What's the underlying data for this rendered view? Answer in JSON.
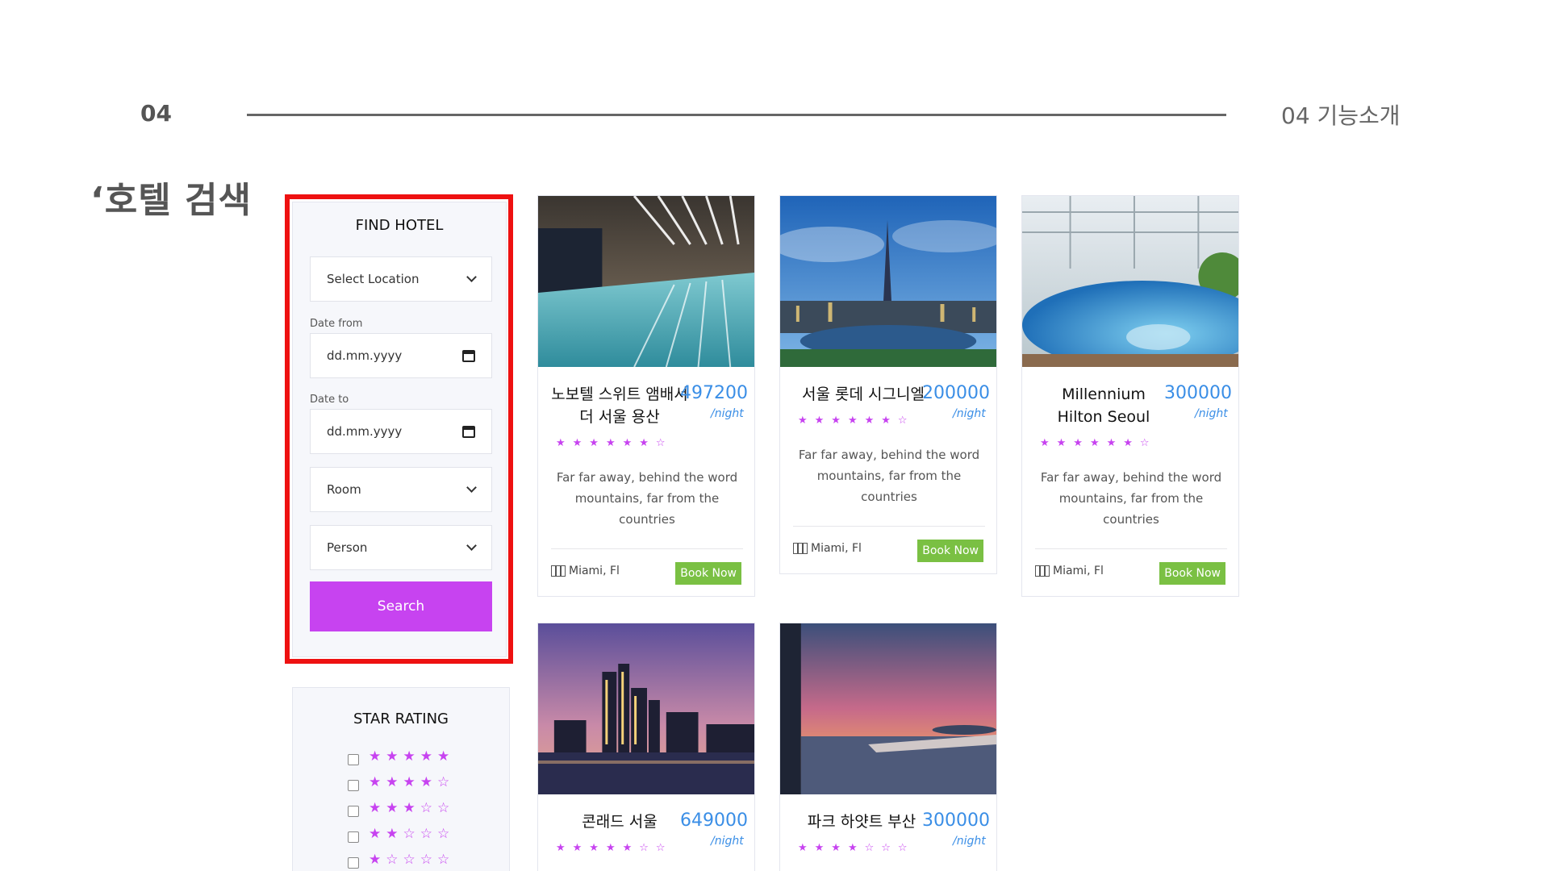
{
  "slide": {
    "number": "04",
    "section": "04 기능소개",
    "heading": "‘호텔 검색"
  },
  "find_hotel": {
    "title": "FIND HOTEL",
    "location_value": "Select Location",
    "date_from_label": "Date from",
    "date_from_value": "dd.mm.yyyy",
    "date_to_label": "Date to",
    "date_to_value": "dd.mm.yyyy",
    "room_value": "Room",
    "person_value": "Person",
    "search_label": "Search"
  },
  "star_rating": {
    "title": "STAR RATING",
    "rows": [
      "★★★★★",
      "★★★★☆",
      "★★★☆☆",
      "★★☆☆☆",
      "★☆☆☆☆"
    ]
  },
  "hotels": [
    {
      "name_1": "노보텔 스위트 앰배서",
      "name_2": "더 서울 용산",
      "price": "497200",
      "per": "/night",
      "stars": "★★★★★★☆",
      "desc_1": "Far far away, behind the word",
      "desc_2": "mountains, far from the",
      "desc_3": "countries",
      "location": "Miami, Fl",
      "book": "Book Now"
    },
    {
      "name_1": "서울 롯데 시그니엘",
      "name_2": "",
      "price": "200000",
      "per": "/night",
      "stars": "★★★★★★☆",
      "desc_1": "Far far away, behind the word",
      "desc_2": "mountains, far from the",
      "desc_3": "countries",
      "location": "Miami, Fl",
      "book": "Book Now"
    },
    {
      "name_1": "Millennium",
      "name_2": "Hilton Seoul",
      "price": "300000",
      "per": "/night",
      "stars": "★★★★★★☆",
      "desc_1": "Far far away, behind the word",
      "desc_2": "mountains, far from the",
      "desc_3": "countries",
      "location": "Miami, Fl",
      "book": "Book Now"
    },
    {
      "name_1": "콘래드 서울",
      "name_2": "",
      "price": "649000",
      "per": "/night",
      "stars": "★★★★★☆☆"
    },
    {
      "name_1": "파크 하얏트 부산",
      "name_2": "",
      "price": "300000",
      "per": "/night",
      "stars": "★★★★☆☆☆"
    }
  ]
}
